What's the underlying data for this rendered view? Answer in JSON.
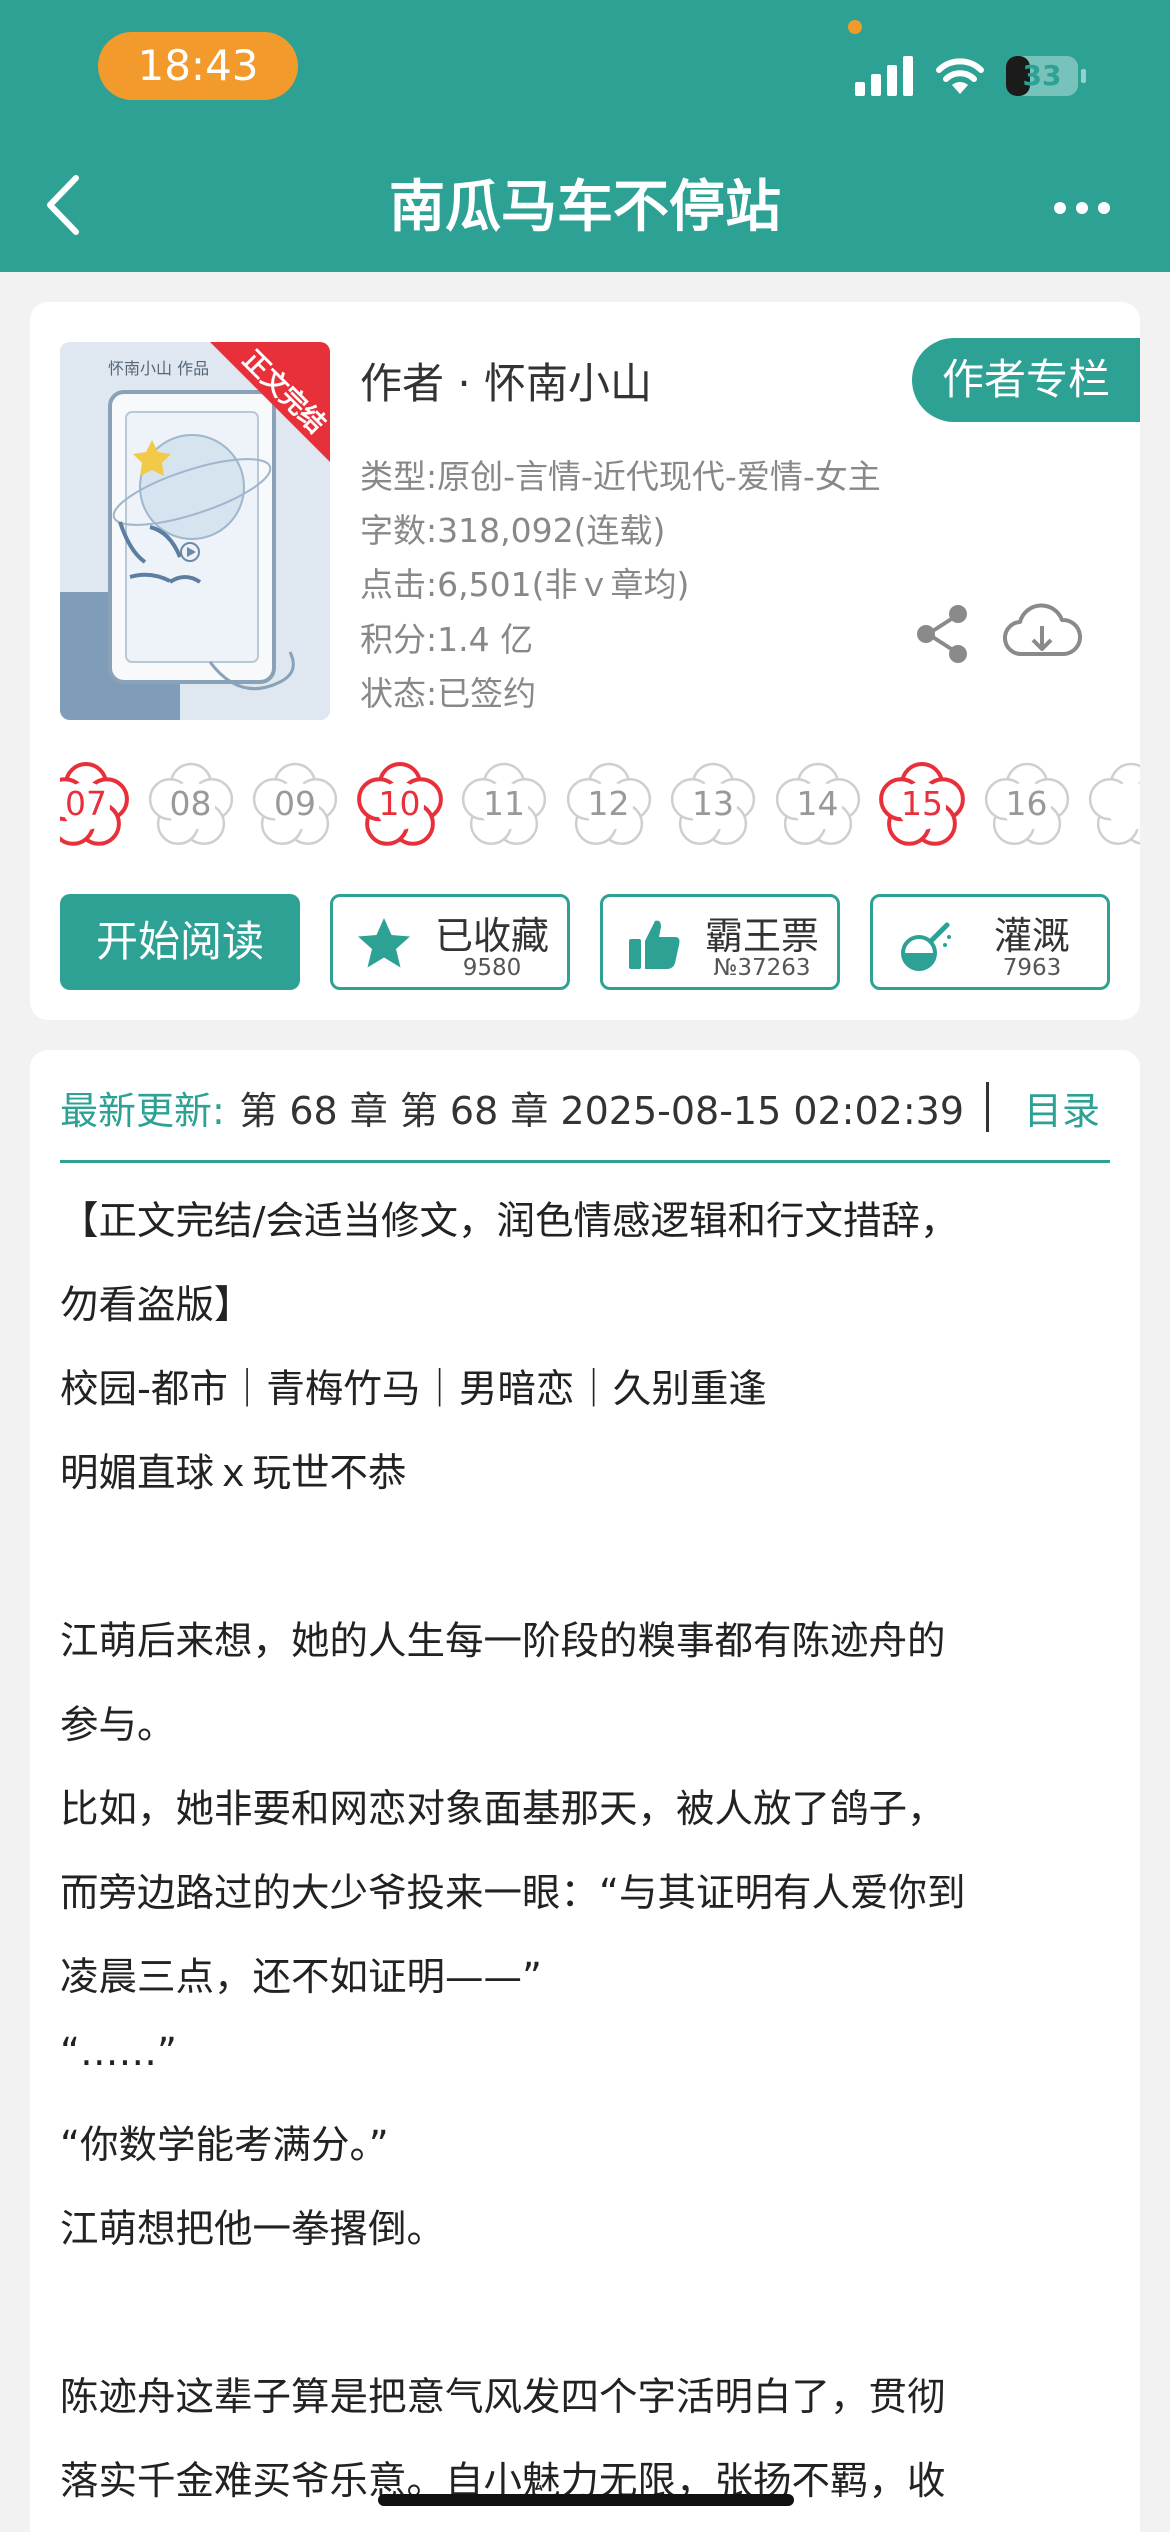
{
  "status_bar": {
    "time": "18:43",
    "battery": "33",
    "battery_level": 0.33
  },
  "header": {
    "title": "南瓜马车不停站"
  },
  "book": {
    "cover": {
      "author_text": "怀南小山 作品",
      "ribbon": "正文完结"
    },
    "author": "作者 · 怀南小山",
    "author_column_button": "作者专栏",
    "meta": [
      "类型:原创-言情-近代现代-爱情-女主",
      "字数:318,092(连载)",
      "点击:6,501(非ｖ章均)",
      "积分:1.4 亿",
      "状态:已签约"
    ]
  },
  "star_days": [
    {
      "label": "07",
      "highlight": true
    },
    {
      "label": "08",
      "highlight": false
    },
    {
      "label": "09",
      "highlight": false
    },
    {
      "label": "10",
      "highlight": true
    },
    {
      "label": "11",
      "highlight": false
    },
    {
      "label": "12",
      "highlight": false
    },
    {
      "label": "13",
      "highlight": false
    },
    {
      "label": "14",
      "highlight": false
    },
    {
      "label": "15",
      "highlight": true
    },
    {
      "label": "16",
      "highlight": false
    },
    {
      "label": "",
      "highlight": false
    }
  ],
  "actions": {
    "start_read": "开始阅读",
    "favorite": {
      "label": "已收藏",
      "count": "9580"
    },
    "bawang": {
      "label": "霸王票",
      "count": "№37263"
    },
    "water": {
      "label": "灌溉",
      "count": "7963"
    }
  },
  "latest_update": {
    "label": "最新更新:",
    "text": "第 68 章 第 68 章 2025-08-15 02:02:39",
    "toc": "目录"
  },
  "synopsis": {
    "lines": [
      "【正文完结/会适当修文，润色情感逻辑和行文措辞，",
      "勿看盗版】",
      "校园-都市｜青梅竹马｜男暗恋｜久别重逢",
      "明媚直球ｘ玩世不恭",
      "",
      "江萌后来想，她的人生每一阶段的糗事都有陈迹舟的",
      "参与。",
      "比如，她非要和网恋对象面基那天，被人放了鸽子，",
      "而旁边路过的大少爷投来一眼：“与其证明有人爱你到",
      "凌晨三点，还不如证明——”",
      "“……”",
      "“你数学能考满分。”",
      "江萌想把他一拳撂倒。",
      "",
      "陈迹舟这辈子算是把意气风发四个字活明白了，贯彻",
      "落实千金难买爷乐意。自小魅力无限，张扬不羁，收"
    ]
  },
  "colors": {
    "brand": "#2ea195",
    "highlight_star": "#e8303a",
    "status_pill": "#f39a2c"
  }
}
